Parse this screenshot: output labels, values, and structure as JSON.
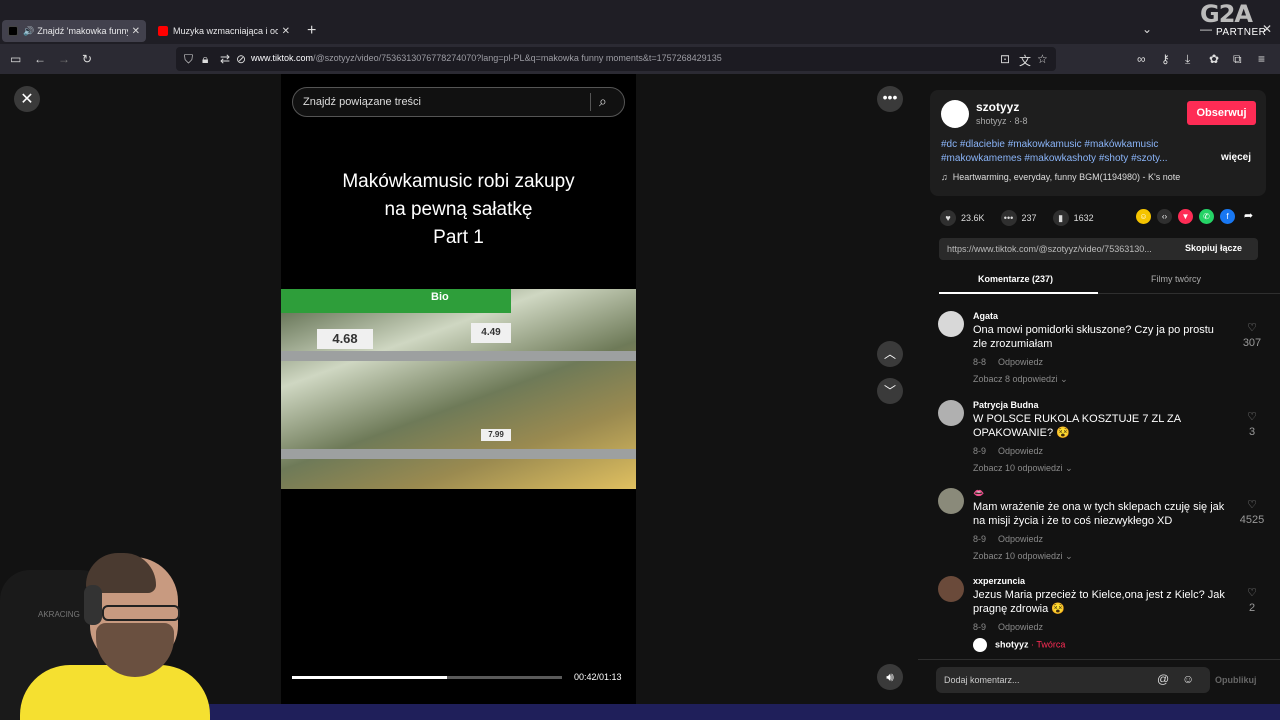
{
  "browser": {
    "tabs": [
      {
        "label": "Znajdź 'makowka funny mo",
        "active": true,
        "icon": "tiktok-icon"
      },
      {
        "label": "Muzyka wzmacniająca i oczyszcz",
        "active": false,
        "icon": "youtube-icon"
      }
    ],
    "url_host": "www.tiktok.com",
    "url_path": "/@szotyyz/video/7536313076778274070?lang=pl-PL&q=makowka funny moments&t=1757268429135",
    "badge_logo": "G2A",
    "badge_partner": "PARTNER"
  },
  "video": {
    "search_placeholder": "Znajdź powiązane treści",
    "title_lines": [
      "Makówkamusic robi zakupy",
      "na pewną sałatkę",
      "Part 1"
    ],
    "price_tags": [
      "4.68",
      "4.49",
      "7.99"
    ],
    "tag_label": "Bio",
    "time": "00:42/01:13",
    "progress": 0.575
  },
  "panel": {
    "author": "szotyyz",
    "author_sub": "shotyyz · 8-8",
    "follow_label": "Obserwuj",
    "tags_line1": "#dc #dlaciebie #makowkamusic #makówkamusic",
    "tags_line2": "#makowkamemes #makowkashoty #shoty #szoty...",
    "more_label": "więcej",
    "music": "Heartwarming, everyday, funny BGM(1194980) - K's note",
    "likes": "23.6K",
    "comments_count": "237",
    "saves": "1632",
    "share_url": "https://www.tiktok.com/@szotyyz/video/75363130...",
    "copy_label": "Skopiuj łącze",
    "tab_comments": "Komentarze (237)",
    "tab_creator": "Filmy twórcy",
    "reply_label": "Odpowiedz",
    "comments": [
      {
        "name": "Agata",
        "text": "Ona mowi pomidorki skłuszone? Czy ja po prostu zle zrozumiałam",
        "date": "8-8",
        "replies": "Zobacz 8 odpowiedzi",
        "likes": "307",
        "avatar_color": "#d8d8d8"
      },
      {
        "name": "Patrycja Budna",
        "text": "W POLSCE RUKOLA KOSZTUJE 7 ZL ZA OPAKOWANIE? 😵",
        "date": "8-9",
        "replies": "Zobacz 10 odpowiedzi",
        "likes": "3",
        "avatar_color": "#b0b0b0"
      },
      {
        "name": "👄",
        "text": "Mam wrażenie że ona w tych sklepach czuję się jak na misji życia i że to coś niezwykłego XD",
        "date": "8-9",
        "replies": "Zobacz 10 odpowiedzi",
        "likes": "4525",
        "avatar_color": "#8a8a7a"
      },
      {
        "name": "xxperzuncia",
        "text": "Jezus Maria przecież to Kielce,ona jest z Kielc? Jak pragnę zdrowia 😵",
        "date": "8-9",
        "replies": "",
        "likes": "2",
        "avatar_color": "#6a4a3a"
      }
    ],
    "creator_reply_name": "shotyyz",
    "creator_badge": "· Twórca",
    "comment_placeholder": "Dodaj komentarz...",
    "publish_label": "Opublikuj"
  },
  "webcam": {
    "chair_label": "AKRACING"
  }
}
